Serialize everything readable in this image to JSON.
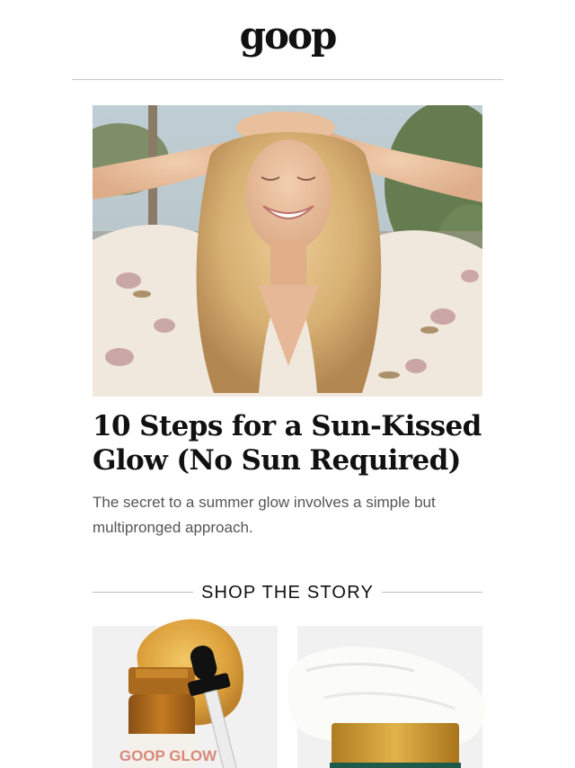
{
  "brand": {
    "logo_text": "goop"
  },
  "article": {
    "headline": "10 Steps for a Sun-Kissed Glow (No Sun Required)",
    "dek": "The secret to a summer glow involves a simple but multipronged approach."
  },
  "shop": {
    "title": "SHOP THE STORY",
    "products": [
      {
        "label_text": "GOOP GLOW",
        "image": "serum-dropper-bottle"
      },
      {
        "image": "cream-jar"
      }
    ]
  },
  "colors": {
    "text": "#111111",
    "muted_text": "#555555",
    "rule": "#c9c9c9",
    "product_bg": "#f1f1f1",
    "serum_amber": "#d49a2a",
    "jar_gold": "#c9962e",
    "jar_green": "#1f5a4a"
  }
}
